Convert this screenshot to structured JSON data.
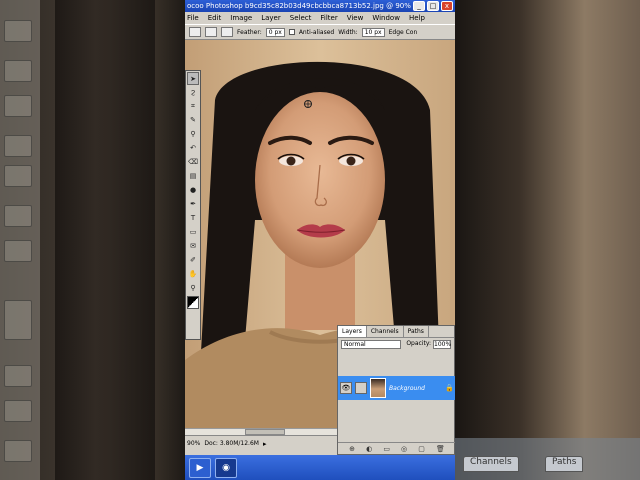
{
  "app": {
    "title": "ocoo Photoshop  b9cd35c82b03d49cbcbbca8713b52.jpg @ 90%",
    "window_buttons": [
      "_",
      "□",
      "x"
    ]
  },
  "menu": [
    "File",
    "Edit",
    "Image",
    "Layer",
    "Select",
    "Filter",
    "View",
    "Window",
    "Help"
  ],
  "options_bar": {
    "feather_label": "Feather:",
    "feather_value": "0 px",
    "antialiased_label": "Anti-aliased",
    "width_label": "Width:",
    "width_value": "10 px",
    "edge_label": "Edge Con"
  },
  "tools": [
    {
      "icon": "move-icon",
      "glyph": "➤"
    },
    {
      "icon": "lasso-icon",
      "glyph": "ϩ"
    },
    {
      "icon": "crop-icon",
      "glyph": "⌗"
    },
    {
      "icon": "brush-icon",
      "glyph": "✎"
    },
    {
      "icon": "stamp-icon",
      "glyph": "⚲"
    },
    {
      "icon": "history-brush-icon",
      "glyph": "↶"
    },
    {
      "icon": "eraser-icon",
      "glyph": "⌫"
    },
    {
      "icon": "gradient-icon",
      "glyph": "▤"
    },
    {
      "icon": "dodge-icon",
      "glyph": "●"
    },
    {
      "icon": "pen-icon",
      "glyph": "✒"
    },
    {
      "icon": "type-icon",
      "glyph": "T"
    },
    {
      "icon": "shape-icon",
      "glyph": "▭"
    },
    {
      "icon": "notes-icon",
      "glyph": "✉"
    },
    {
      "icon": "eyedropper-icon",
      "glyph": "✐"
    },
    {
      "icon": "hand-icon",
      "glyph": "✋"
    },
    {
      "icon": "zoom-icon",
      "glyph": "⚲"
    }
  ],
  "layers_panel": {
    "tabs": [
      "Layers",
      "Channels",
      "Paths"
    ],
    "blend_mode": "Normal",
    "opacity_label": "Opacity:",
    "opacity_value": "100%",
    "layer_name": "Background",
    "footer_icons": [
      "⊕",
      "◐",
      "▭",
      "◎",
      "▢",
      "🗑"
    ]
  },
  "status": {
    "zoom": "90%",
    "doc": "Doc: 3.80M/12.6M"
  },
  "taskbar": {
    "buttons": [
      "▶",
      "◉"
    ]
  },
  "background_tabs": [
    "Channels",
    "Paths"
  ],
  "colors": {
    "accent": "#3a8df0",
    "titlebar": "#2d5fd6",
    "taskbar": "#1f4fbd"
  }
}
